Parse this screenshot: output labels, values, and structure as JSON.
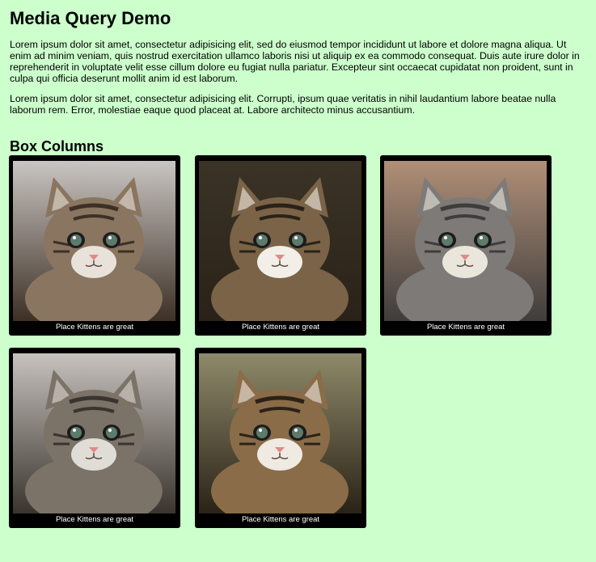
{
  "page": {
    "title": "Media Query Demo",
    "paragraphs": [
      "Lorem ipsum dolor sit amet, consectetur adipisicing elit, sed do eiusmod tempor incididunt ut labore et dolore magna aliqua. Ut enim ad minim veniam, quis nostrud exercitation ullamco laboris nisi ut aliquip ex ea commodo consequat. Duis aute irure dolor in reprehenderit in voluptate velit esse cillum dolore eu fugiat nulla pariatur. Excepteur sint occaecat cupidatat non proident, sunt in culpa qui officia deserunt mollit anim id est laborum.",
      "Lorem ipsum dolor sit amet, consectetur adipisicing elit. Corrupti, ipsum quae veritatis in nihil laudantium labore beatae nulla laborum rem. Error, molestiae eaque quod placeat at. Labore architecto minus accusantium."
    ],
    "section_heading": "Box Columns"
  },
  "cards": [
    {
      "caption": "Place Kittens are great",
      "photo": "kitten-photo",
      "palette": {
        "bg": "#c9c5c2",
        "fur": "#8a7560",
        "dark": "#3d3025",
        "light": "#e8e2da"
      }
    },
    {
      "caption": "Place Kittens are great",
      "photo": "kitten-photo",
      "palette": {
        "bg": "#3a3326",
        "fur": "#7a6347",
        "dark": "#2a2218",
        "light": "#f2eee8"
      }
    },
    {
      "caption": "Place Kittens are great",
      "photo": "kitten-photo",
      "palette": {
        "bg": "#b08f77",
        "fur": "#7d7a78",
        "dark": "#3f3d3c",
        "light": "#eae6dc"
      }
    },
    {
      "caption": "Place Kittens are great",
      "photo": "kitten-photo",
      "palette": {
        "bg": "#c7c2bd",
        "fur": "#7b7268",
        "dark": "#3a342f",
        "light": "#e0dcd6"
      }
    },
    {
      "caption": "Place Kittens are great",
      "photo": "kitten-photo",
      "palette": {
        "bg": "#8e8a6a",
        "fur": "#8a6c48",
        "dark": "#2b2217",
        "light": "#efeae2"
      }
    }
  ]
}
